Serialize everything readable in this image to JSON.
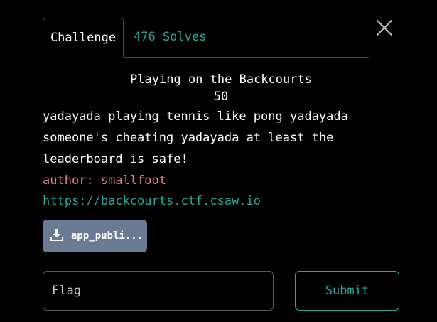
{
  "tabs": {
    "challenge_label": "Challenge",
    "solves_label": "476 Solves"
  },
  "challenge": {
    "title": "Playing on the Backcourts",
    "points": "50",
    "description_lines": [
      "yadayada playing tennis like pong yadayada",
      "someone's cheating yadayada at least the",
      "leaderboard is safe!"
    ],
    "author": "author: smallfoot",
    "link": "https://backcourts.ctf.csaw.io",
    "file_label": "app_publi..."
  },
  "form": {
    "flag_placeholder": "Flag",
    "flag_value": "",
    "submit_label": "Submit"
  },
  "icons": {
    "close": "close-icon",
    "download": "download-icon"
  },
  "colors": {
    "background": "#000000",
    "accent": "#2aa596",
    "author": "#e8799e",
    "file_button": "#6b7a94"
  }
}
